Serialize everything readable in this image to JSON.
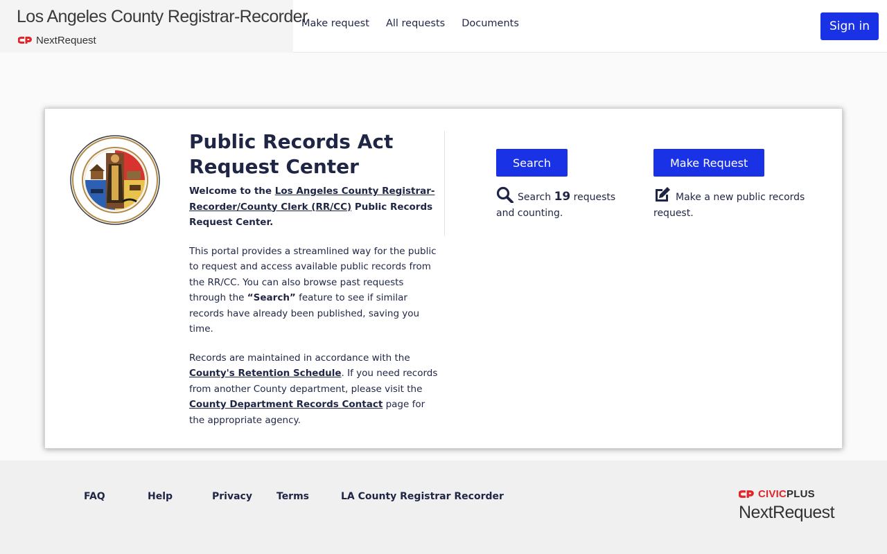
{
  "header": {
    "brand_title": "Los Angeles County Registrar-Recorder",
    "brand_sub": "NextRequest",
    "nav": [
      "Make request",
      "All requests",
      "Documents"
    ],
    "signin_label": "Sign in"
  },
  "main": {
    "title_line1": "Public Records Act",
    "title_line2": "Request Center",
    "welcome_prefix": "Welcome to the ",
    "welcome_link": "Los Angeles County Registrar-Recorder/County Clerk (RR/CC)",
    "welcome_suffix": " Public Records Request Center.",
    "para1_a": "This portal provides a streamlined way for the public to request and access available public records from the RR/CC. You can also browse past requests through the ",
    "para1_bold": "“Search”",
    "para1_b": " feature to see if similar records have already been published, saving you time.",
    "para2_a": "Records are maintained in accordance with the ",
    "para2_link1": "County's Retention Schedule",
    "para2_b": ". If you need records from another County department, please visit the ",
    "para2_link2": "County Department Records Contact",
    "para2_c": " page for the appropriate agency."
  },
  "search": {
    "button_label": "Search",
    "desc_prefix": "Search ",
    "count": "19",
    "desc_suffix": " requests and counting.",
    "icon": "search-icon"
  },
  "make_request": {
    "button_label": "Make Request",
    "desc": "Make a new public records request.",
    "icon": "edit-icon"
  },
  "footer": {
    "links": [
      "FAQ",
      "Help",
      "Privacy",
      "Terms",
      "LA County Registrar Recorder"
    ],
    "logo_brand_a": "CIVIC",
    "logo_brand_b": "PLUS",
    "logo_product": "NextRequest"
  },
  "colors": {
    "primary": "#1a32e6",
    "text": "#1f2544",
    "civicplus_red": "#e0262b"
  }
}
